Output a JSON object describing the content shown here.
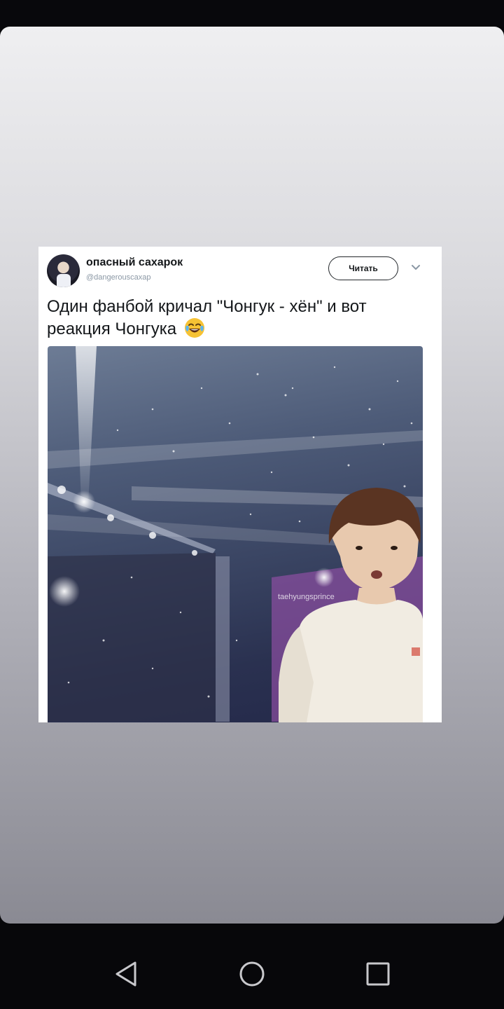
{
  "tweet": {
    "user_name": "опасный сахарок",
    "user_handle": "@dangerouscaxap",
    "follow_label": "Читать",
    "text": "Один фанбой кричал \"Чонгук - хён\" и вот реакция Чонгука",
    "emoji": "face-with-tears-of-joy",
    "watermark": "taehyungsprince"
  },
  "navigation": {
    "back_icon": "back-triangle-icon",
    "home_icon": "home-circle-icon",
    "recents_icon": "recents-square-icon"
  },
  "colors": {
    "card_top": "#efeff1",
    "card_bottom": "#8a8a93",
    "nav_background": "#07070a"
  }
}
